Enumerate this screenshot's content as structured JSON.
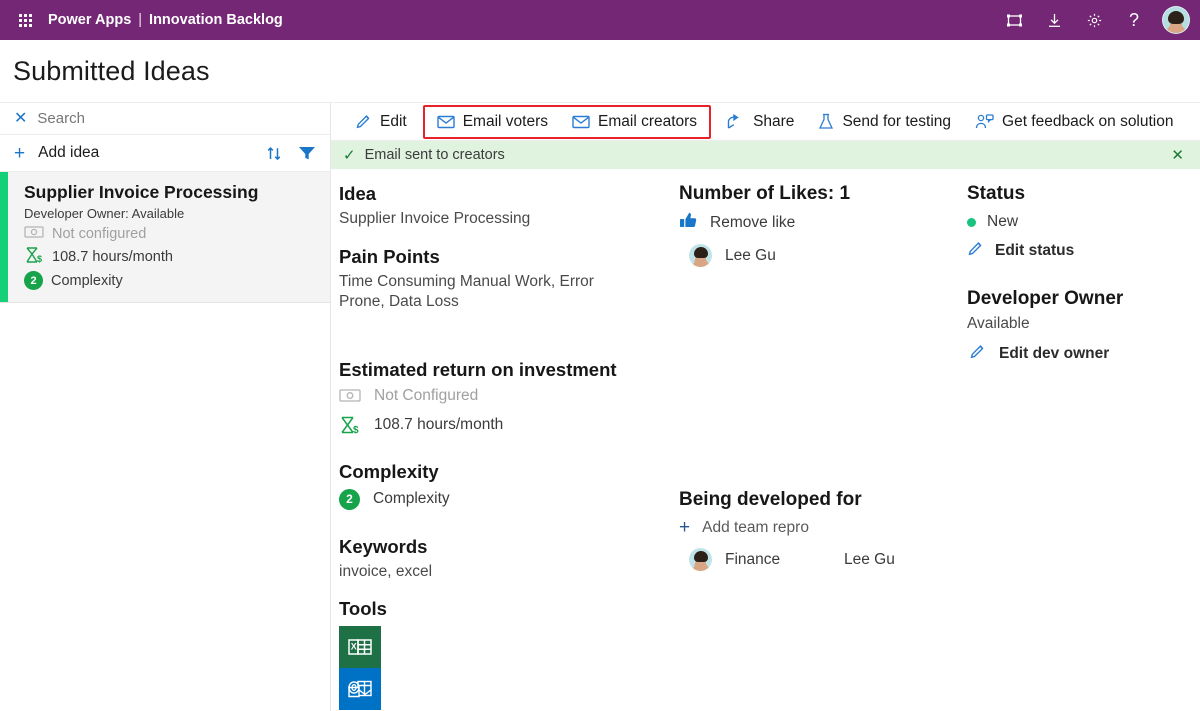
{
  "topbar": {
    "waffle_icon": "app-launcher-icon",
    "app_name": "Power Apps",
    "separator": "|",
    "page_name": "Innovation Backlog",
    "icons": [
      "fullscreen-icon",
      "download-icon",
      "gear-icon",
      "help-icon"
    ],
    "help_glyph": "?",
    "background": "#742774"
  },
  "page": {
    "title": "Submitted Ideas"
  },
  "sidebar": {
    "search": {
      "placeholder": "Search",
      "clear_glyph": "✕"
    },
    "add": {
      "plus_glyph": "+",
      "label": "Add idea"
    },
    "sort_icon": "sort-icon",
    "filter_icon": "filter-icon",
    "card": {
      "title": "Supplier Invoice Processing",
      "subtitle": "Developer Owner: Available",
      "money_label": "Not configured",
      "hours_label": "108.7 hours/month",
      "complexity_badge": "2",
      "complexity_label": "Complexity",
      "accent_color": "#15d077"
    }
  },
  "toolbar": {
    "edit": "Edit",
    "email_voters": "Email voters",
    "email_creators": "Email creators",
    "share": "Share",
    "send_for_testing": "Send for testing",
    "get_feedback": "Get feedback on solution",
    "highlight_color": "#e8222a"
  },
  "banner": {
    "message": "Email sent to creators",
    "check_glyph": "✓",
    "close_glyph": "✕",
    "background": "#dff3df"
  },
  "details": {
    "idea_heading": "Idea",
    "idea_value": "Supplier Invoice Processing",
    "pain_points_heading": "Pain Points",
    "pain_points_value": "Time Consuming Manual Work, Error Prone, Data Loss",
    "roi_heading": "Estimated return on investment",
    "roi_money": "Not Configured",
    "roi_hours": "108.7 hours/month",
    "complexity_heading": "Complexity",
    "complexity_badge": "2",
    "complexity_value": "Complexity",
    "keywords_heading": "Keywords",
    "keywords_value": "invoice, excel",
    "tools_heading": "Tools",
    "tools": [
      "excel-icon",
      "outlook-icon"
    ]
  },
  "likes": {
    "heading": "Number of Likes: 1",
    "remove_like": "Remove like",
    "voter": "Lee Gu"
  },
  "developed_for": {
    "heading": "Being developed for",
    "add_label": "Add team repro",
    "plus_glyph": "+",
    "team": "Finance",
    "owner": "Lee Gu"
  },
  "status": {
    "heading": "Status",
    "value": "New",
    "dot_color": "#19c37d",
    "edit_status": "Edit status",
    "dev_owner_heading": "Developer Owner",
    "dev_owner_value": "Available",
    "edit_dev_owner": "Edit dev owner"
  }
}
